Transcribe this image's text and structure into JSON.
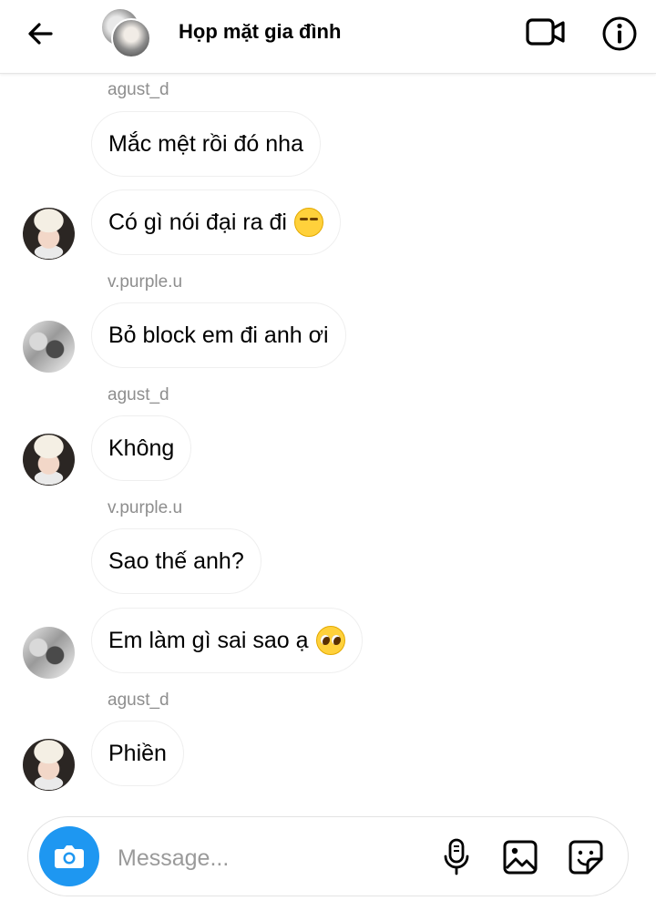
{
  "header": {
    "title": "Họp mặt gia đình",
    "back_icon": "arrow-left-icon",
    "video_icon": "video-camera-icon",
    "info_icon": "info-icon"
  },
  "messages": [
    {
      "sender": "agust_d",
      "text": "Mắc mệt rồi đó nha",
      "avatar": false
    },
    {
      "text": "Có gì nói đại ra đi",
      "emoji": "unamused-face",
      "avatar": true
    },
    {
      "sender": "v.purple.u",
      "text": "Bỏ block em đi anh ơi",
      "avatar": true
    },
    {
      "sender": "agust_d",
      "text": "Không",
      "avatar": true
    },
    {
      "sender": "v.purple.u",
      "text": "Sao thế anh?",
      "avatar": false
    },
    {
      "text": "Em làm gì sai sao ạ",
      "emoji": "pleading-face",
      "avatar": true
    },
    {
      "sender": "agust_d",
      "text": "Phiền",
      "avatar": true
    }
  ],
  "composer": {
    "placeholder": "Message...",
    "camera_icon": "camera-icon",
    "mic_icon": "microphone-icon",
    "gallery_icon": "image-icon",
    "sticker_icon": "sticker-icon",
    "accent": "#1e97f1"
  }
}
